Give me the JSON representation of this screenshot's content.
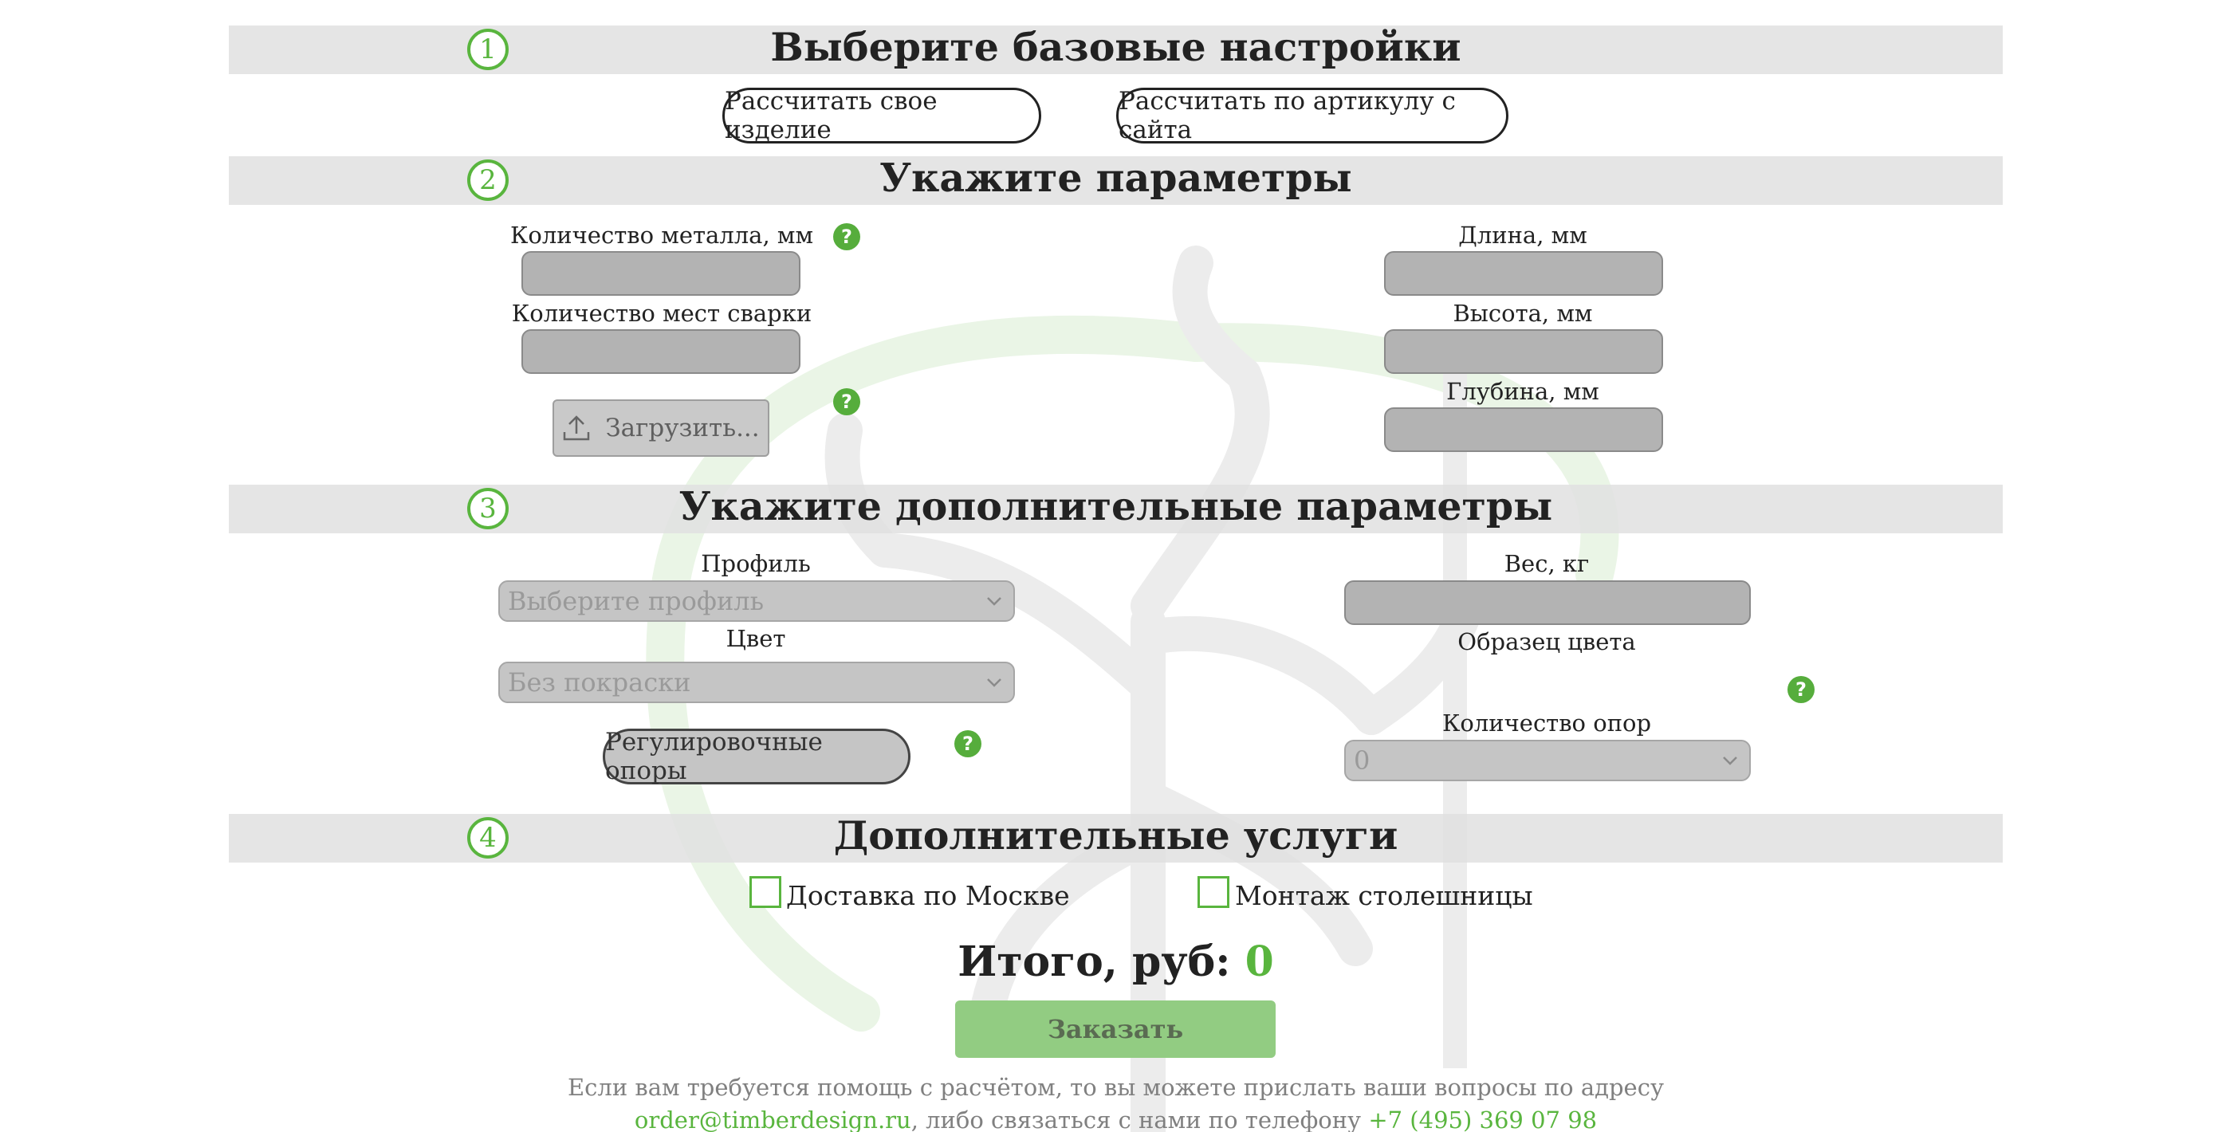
{
  "sections": [
    {
      "number": "1",
      "title": "Выберите базовые настройки"
    },
    {
      "number": "2",
      "title": "Укажите параметры"
    },
    {
      "number": "3",
      "title": "Укажите дополнительные параметры"
    },
    {
      "number": "4",
      "title": "Дополнительные услуги"
    }
  ],
  "base_settings": {
    "calc_own_label": "Рассчитать свое изделие",
    "calc_by_article_label": "Рассчитать по артикулу с сайта"
  },
  "parameters": {
    "metal_label": "Количество металла, мм",
    "metal_value": "",
    "weld_label": "Количество мест сварки",
    "weld_value": "",
    "upload_label": "Загрузить...",
    "length_label": "Длина, мм",
    "length_value": "",
    "height_label": "Высота, мм",
    "height_value": "",
    "depth_label": "Глубина, мм",
    "depth_value": ""
  },
  "extra_params": {
    "profile_label": "Профиль",
    "profile_selected": "Выберите профиль",
    "color_label": "Цвет",
    "color_selected": "Без покраски",
    "adjustable_supports_label": "Регулировочные опоры",
    "weight_label": "Вес, кг",
    "weight_value": "",
    "color_sample_label": "Образец цвета",
    "supports_count_label": "Количество опор",
    "supports_count_selected": "0"
  },
  "services": {
    "delivery_label": "Доставка по Москве",
    "delivery_checked": false,
    "mounting_label": "Монтаж столешницы",
    "mounting_checked": false
  },
  "total": {
    "label": "Итого, руб:",
    "value": "0"
  },
  "order_button_label": "Заказать",
  "help": {
    "line1": "Если вам требуется помощь с расчётом, то вы можете прислать ваши вопросы по адресу",
    "email": "order@timberdesign.ru",
    "middle": ", либо связаться с нами по телефону ",
    "phone": "+7 (495) 369 07 98"
  },
  "help_icon_glyph": "?",
  "colors": {
    "accent_green": "#59b53e",
    "section_bar": "#e0e0e0",
    "input_fill": "#b3b3b3",
    "order_button": "#92cc82"
  }
}
